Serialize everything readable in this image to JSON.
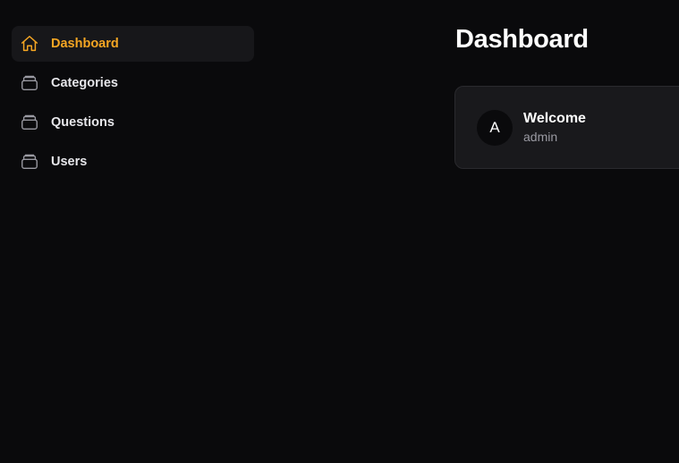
{
  "colors": {
    "background": "#0a0a0c",
    "accent": "#f5a623",
    "card": "#19191c",
    "text": "#e6e6ea",
    "muted": "#9a9aa2"
  },
  "sidebar": {
    "items": [
      {
        "label": "Dashboard",
        "icon": "home-icon",
        "active": true
      },
      {
        "label": "Categories",
        "icon": "inbox-icon",
        "active": false
      },
      {
        "label": "Questions",
        "icon": "inbox-icon",
        "active": false
      },
      {
        "label": "Users",
        "icon": "inbox-icon",
        "active": false
      }
    ]
  },
  "main": {
    "title": "Dashboard",
    "welcome_card": {
      "avatar_initial": "A",
      "title": "Welcome",
      "subtitle": "admin"
    }
  }
}
